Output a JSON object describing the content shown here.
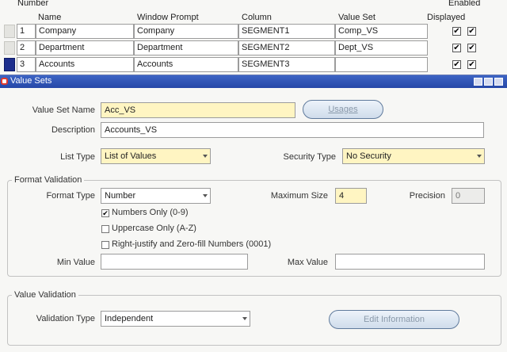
{
  "grid": {
    "headers": {
      "number": "Number",
      "name": "Name",
      "window_prompt": "Window Prompt",
      "column": "Column",
      "value_set": "Value Set",
      "displayed": "Displayed",
      "enabled": "Enabled"
    },
    "rows": [
      {
        "number": "1",
        "name": "Company",
        "window_prompt": "Company",
        "column": "SEGMENT1",
        "value_set": "Comp_VS",
        "displayed": true,
        "enabled": true
      },
      {
        "number": "2",
        "name": "Department",
        "window_prompt": "Department",
        "column": "SEGMENT2",
        "value_set": "Dept_VS",
        "displayed": true,
        "enabled": true
      },
      {
        "number": "3",
        "name": "Accounts",
        "window_prompt": "Accounts",
        "column": "SEGMENT3",
        "value_set": "",
        "displayed": true,
        "enabled": true
      }
    ]
  },
  "dialog": {
    "title": "Value Sets",
    "value_set_name_label": "Value Set Name",
    "value_set_name": "Acc_VS",
    "usages_button": "Usages",
    "description_label": "Description",
    "description": "Accounts_VS",
    "list_type_label": "List Type",
    "list_type": "List of Values",
    "security_type_label": "Security Type",
    "security_type": "No Security",
    "format_validation": {
      "title": "Format Validation",
      "format_type_label": "Format Type",
      "format_type": "Number",
      "maximum_size_label": "Maximum Size",
      "maximum_size": "4",
      "precision_label": "Precision",
      "precision": "0",
      "numbers_only_label": "Numbers Only (0-9)",
      "numbers_only": true,
      "uppercase_only_label": "Uppercase Only (A-Z)",
      "uppercase_only": false,
      "right_justify_label": "Right-justify and Zero-fill Numbers (0001)",
      "right_justify": false,
      "min_value_label": "Min Value",
      "min_value": "",
      "max_value_label": "Max Value",
      "max_value": ""
    },
    "value_validation": {
      "title": "Value Validation",
      "validation_type_label": "Validation Type",
      "validation_type": "Independent",
      "edit_information_button": "Edit Information"
    }
  },
  "colors": {
    "titlebar": "#2f55b8",
    "required_field": "#fff5c2",
    "selected_row": "#1d2e8c"
  }
}
